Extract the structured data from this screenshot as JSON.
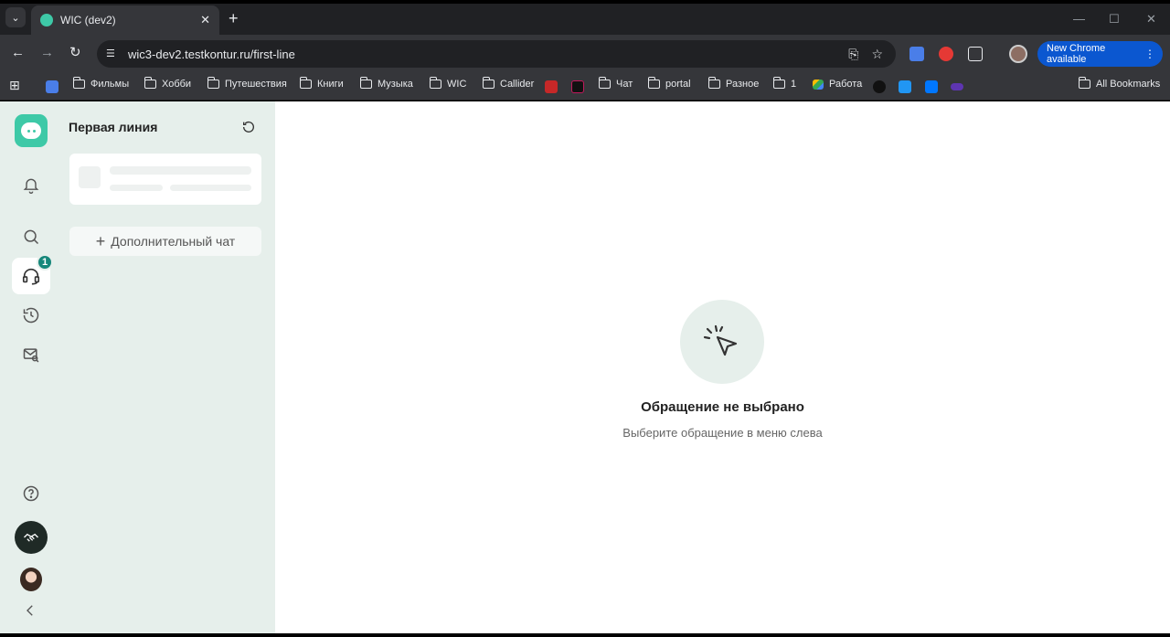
{
  "browser": {
    "tab_title": "WIC (dev2)",
    "new_tab": "+",
    "url": "wic3-dev2.testkontur.ru/first-line",
    "update_button": "New Chrome available",
    "bookmarks": [
      "Фильмы",
      "Хобби",
      "Путешествия",
      "Книги",
      "Музыка",
      "WIC",
      "Callider",
      "Чат",
      "portal",
      "Разное",
      "1",
      "Работа"
    ],
    "all_bookmarks": "All Bookmarks"
  },
  "rail": {
    "badge_count": "1"
  },
  "panel": {
    "title": "Первая линия",
    "add_chat_label": "Дополнительный чат"
  },
  "main": {
    "empty_title": "Обращение не выбрано",
    "empty_subtitle": "Выберите обращение в меню слева"
  },
  "colors": {
    "accent": "#3ec9a7",
    "badge": "#16877a",
    "panel_bg": "#e6efeb",
    "chrome_update": "#0b57d0"
  }
}
